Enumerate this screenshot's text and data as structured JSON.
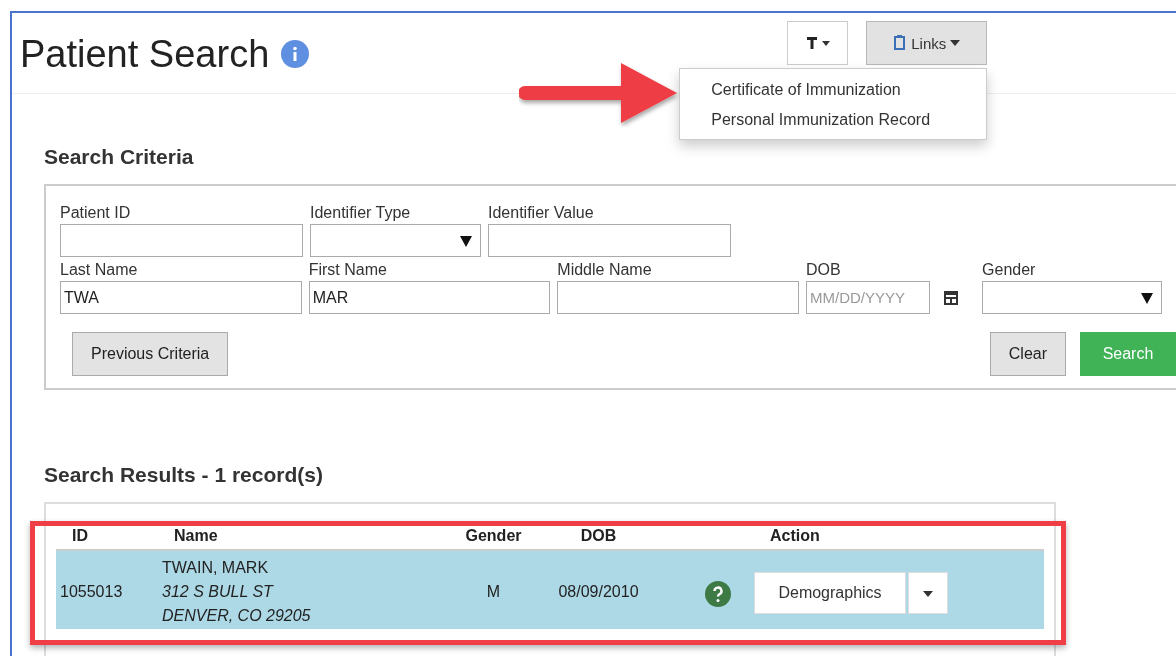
{
  "page": {
    "title": "Patient Search"
  },
  "toolbar": {
    "tools_button": {
      "expanded": false
    },
    "links_button": {
      "label": "Links",
      "expanded": true
    }
  },
  "links_menu": {
    "items": [
      "Certificate of Immunization",
      "Personal Immunization Record"
    ]
  },
  "search_criteria": {
    "heading": "Search Criteria",
    "field_rows": [
      [
        {
          "label": "Patient ID",
          "kind": "text"
        },
        {
          "label": "Identifier Type",
          "kind": "select"
        },
        {
          "label": "Identifier Value",
          "kind": "text"
        }
      ],
      [
        {
          "label": "Last Name",
          "kind": "text",
          "value": "TWA"
        },
        {
          "label": "First Name",
          "kind": "text",
          "value": "MAR"
        },
        {
          "label": "Middle Name",
          "kind": "text"
        },
        {
          "label": "DOB",
          "kind": "date",
          "placeholder": "MM/DD/YYYY"
        },
        {
          "label": "Gender",
          "kind": "select"
        }
      ]
    ],
    "left_buttons": [
      {
        "label": "Previous Criteria",
        "kind": "default"
      }
    ],
    "right_buttons": [
      {
        "label": "Clear",
        "kind": "default"
      },
      {
        "label": "Search",
        "kind": "primary"
      }
    ]
  },
  "results": {
    "heading": "Search Results - 1 record(s)",
    "columns": [
      "ID",
      "Name",
      "Gender",
      "DOB",
      "Action"
    ],
    "rows": [
      {
        "id": "1055013",
        "name": "TWAIN, MARK",
        "address_lines": [
          "312 S BULL ST",
          "DENVER, CO 29205"
        ],
        "gender": "M",
        "dob": "08/09/2010",
        "action": "Demographics",
        "selected": true
      }
    ]
  },
  "annotations": {
    "arrow": true,
    "highlight_frame": true
  }
}
